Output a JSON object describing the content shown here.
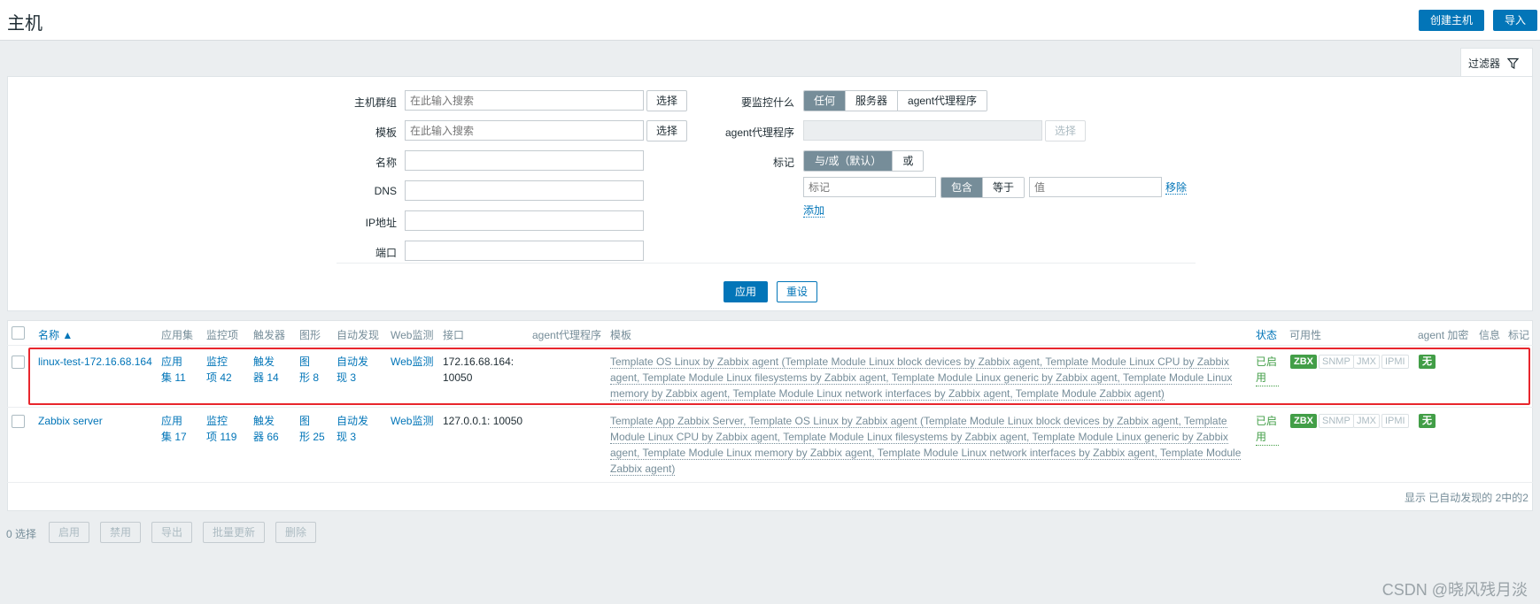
{
  "header": {
    "title": "主机",
    "create_host_label": "创建主机",
    "import_label": "导入"
  },
  "filter": {
    "tab_label": "过滤器",
    "host_group_label": "主机群组",
    "host_group_placeholder": "在此输入搜索",
    "template_label": "模板",
    "template_placeholder": "在此输入搜索",
    "select_label": "选择",
    "name_label": "名称",
    "dns_label": "DNS",
    "ip_label": "IP地址",
    "port_label": "端口",
    "monitored_by_label": "要监控什么",
    "monitored_by_options": [
      "任何",
      "服务器",
      "agent代理程序"
    ],
    "proxy_label": "agent代理程序",
    "tags_label": "标记",
    "tags_logic_options": [
      "与/或（默认）",
      "或"
    ],
    "tag_placeholder": "标记",
    "tag_operator_options": [
      "包含",
      "等于"
    ],
    "tag_value_placeholder": "值",
    "remove_label": "移除",
    "add_label": "添加",
    "apply_label": "应用",
    "reset_label": "重设"
  },
  "table": {
    "columns": {
      "name": "名称 ▲",
      "applications": "应用集",
      "items": "监控项",
      "triggers": "触发器",
      "graphs": "图形",
      "discovery": "自动发现",
      "web": "Web监测",
      "interface": "接口",
      "proxy": "agent代理程序",
      "templates": "模板",
      "status": "状态",
      "availability": "可用性",
      "encryption": "agent 加密",
      "info": "信息",
      "tags": "标记"
    },
    "rows": [
      {
        "name": "linux-test-172.16.68.164",
        "applications": [
          "应用",
          "集 11"
        ],
        "items": [
          "监控",
          "项 42"
        ],
        "triggers": [
          "触发",
          "器 14"
        ],
        "graphs": [
          "图",
          "形 8"
        ],
        "discovery": [
          "自动发",
          "现 3"
        ],
        "web": "Web监测",
        "interface": [
          "172.16.68.164:",
          "10050"
        ],
        "templates": [
          "Template OS Linux by Zabbix agent (Template Module Linux block devices by Zabbix agent, Template Module Linux CPU by Zabbix",
          "agent, Template Module Linux filesystems by Zabbix agent, Template Module Linux generic by Zabbix agent, Template Module Linux",
          "memory by Zabbix agent, Template Module Linux network interfaces by Zabbix agent, Template Module Zabbix agent)"
        ],
        "status": [
          "已启",
          "用"
        ],
        "encryption": "无"
      },
      {
        "name": "Zabbix server",
        "applications": [
          "应用",
          "集 17"
        ],
        "items": [
          "监控",
          "项 119"
        ],
        "triggers": [
          "触发",
          "器 66"
        ],
        "graphs": [
          "图",
          "形 25"
        ],
        "discovery": [
          "自动发",
          "现 3"
        ],
        "web": "Web监测",
        "interface": [
          "127.0.0.1: 10050"
        ],
        "templates": [
          "Template App Zabbix Server, Template OS Linux by Zabbix agent (Template Module Linux block devices by Zabbix agent, Template",
          "Module Linux CPU by Zabbix agent, Template Module Linux filesystems by Zabbix agent, Template Module Linux generic by Zabbix",
          "agent, Template Module Linux memory by Zabbix agent, Template Module Linux network interfaces by Zabbix agent, Template Module",
          "Zabbix agent)"
        ],
        "status": [
          "已启",
          "用"
        ],
        "encryption": "无"
      }
    ],
    "availability_badges": [
      "ZBX",
      "SNMP",
      "JMX",
      "IPMI"
    ],
    "footer_info": "显示 已自动发现的 2中的2"
  },
  "actions": {
    "selected_count": "0 选择",
    "buttons": [
      "启用",
      "禁用",
      "导出",
      "批量更新",
      "删除"
    ]
  },
  "watermark": "CSDN @晓风残月淡",
  "colors": {
    "accent": "#0275b8",
    "status_green": "#429e47",
    "highlight_red": "#e8262d"
  }
}
